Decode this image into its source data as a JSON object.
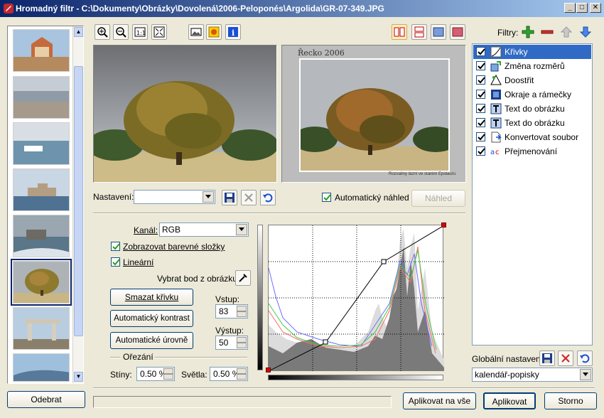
{
  "window": {
    "title": "Hromadný filtr - C:\\Dokumenty\\Obrázky\\Dovolená\\2006-Peloponés\\Argolida\\GR-07-349.JPG",
    "minimize": "_",
    "maximize": "□",
    "close": "✕"
  },
  "left": {
    "remove_label": "Odebrat",
    "thumbnails": [
      "church",
      "harbor",
      "boat",
      "fortress",
      "castle-sea",
      "tree",
      "ruins",
      "coast"
    ],
    "selected_index": 5
  },
  "preview": {
    "caption": "Řecko 2006",
    "footnote": "Rozvaliny lázní ve starém Epidauru"
  },
  "settings": {
    "label": "Nastavení:",
    "value": "",
    "auto_preview_label": "Automatický náhled",
    "auto_preview_checked": true,
    "preview_button": "Náhled"
  },
  "curves": {
    "channel_label": "Kanál:",
    "channel_value": "RGB",
    "show_components_label": "Zobrazovat barevné složky",
    "show_components_checked": true,
    "linear_label": "Lineární",
    "linear_checked": true,
    "pick_point_label": "Vybrat bod z obrázku:",
    "clear_curve": "Smazat křivku",
    "auto_contrast": "Automatický kontrast",
    "auto_levels": "Automatické úrovně",
    "input_label": "Vstup:",
    "input_value": "83",
    "output_label": "Výstup:",
    "output_value": "50",
    "crop_label": "Ořezání",
    "shadows_label": "Stíny:",
    "shadows_value": "0.50 %",
    "highlights_label": "Světla:",
    "highlights_value": "0.50 %"
  },
  "filters": {
    "label": "Filtry:",
    "items": [
      {
        "label": "Křivky",
        "icon": "curves-icon",
        "checked": true
      },
      {
        "label": "Změna rozměrů",
        "icon": "resize-icon",
        "checked": true
      },
      {
        "label": "Doostřit",
        "icon": "sharpen-icon",
        "checked": true
      },
      {
        "label": "Okraje a rámečky",
        "icon": "frame-icon",
        "checked": true
      },
      {
        "label": "Text do obrázku",
        "icon": "text-icon",
        "checked": true
      },
      {
        "label": "Text do obrázku",
        "icon": "text-icon",
        "checked": true
      },
      {
        "label": "Konvertovat soubor",
        "icon": "convert-icon",
        "checked": true
      },
      {
        "label": "Přejmenování",
        "icon": "rename-icon",
        "checked": true
      }
    ],
    "selected_index": 0,
    "global_label": "Globální nastavení:",
    "global_value": "kalendář-popisky"
  },
  "footer": {
    "apply_all": "Aplikovat na vše",
    "apply": "Aplikovat",
    "cancel": "Storno"
  },
  "colors": {
    "titlebar_start": "#0a246a",
    "selection": "#316ac5",
    "face": "#ece9d8"
  }
}
